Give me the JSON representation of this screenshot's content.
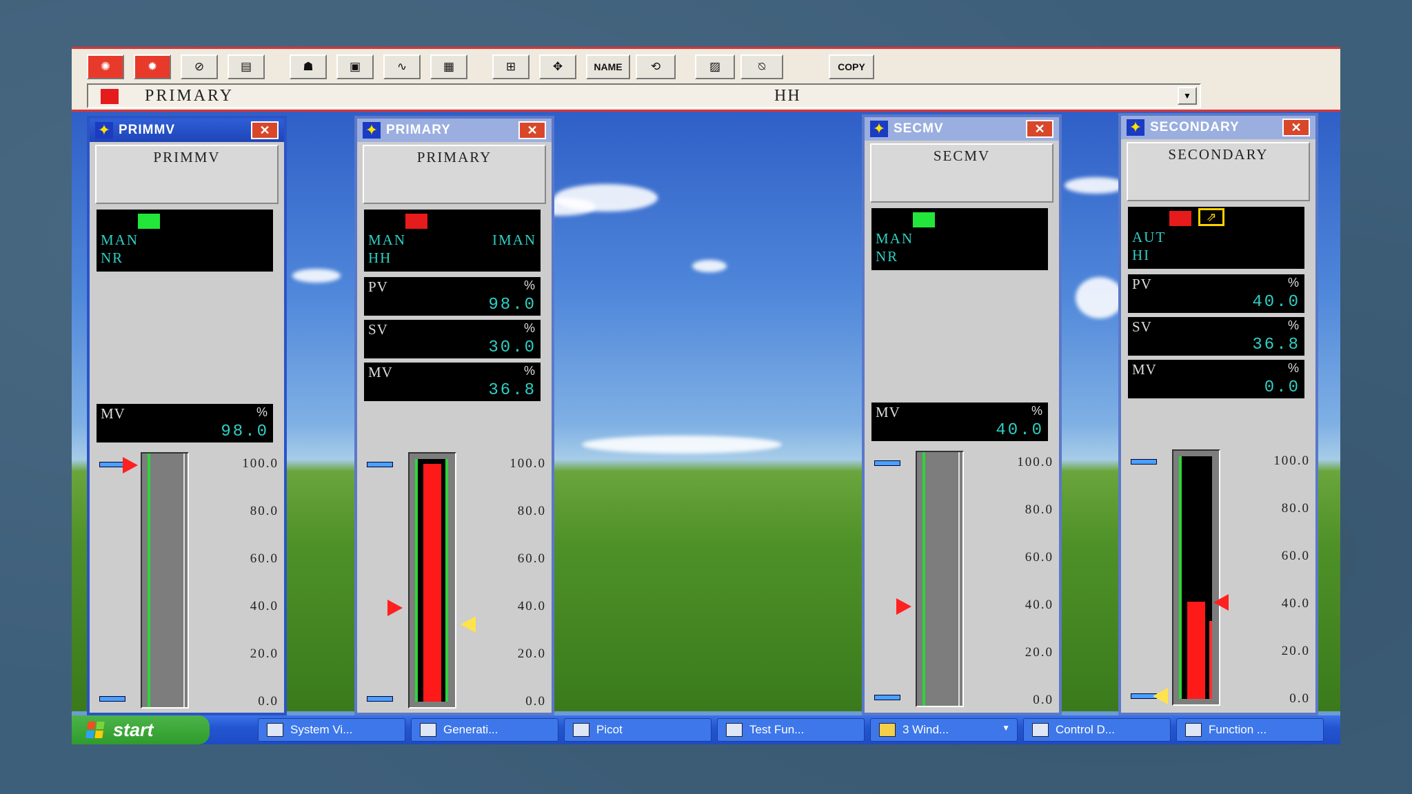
{
  "toolbar": {
    "buttons": [
      "alarm-icon",
      "process-alarm-icon",
      "operator-guide-icon",
      "message-icon",
      "operator-icon",
      "display-icon",
      "trend-icon",
      "overview-icon",
      "graphic-icon",
      "navigate-icon",
      "NAME",
      "tuning-icon",
      "filter-icon",
      "acknowledge-icon",
      "COPY"
    ],
    "name_label": "NAME",
    "copy_label": "COPY"
  },
  "tag_row": {
    "name": "PRIMARY",
    "alarm": "HH",
    "color": "#e61b1b"
  },
  "faceplates": [
    {
      "title": "PRIMMV",
      "name": "PRIMMV",
      "indicator_color": "#22e63a",
      "mode": "MAN",
      "mode2": "",
      "alarm": "NR",
      "mv": {
        "label": "MV",
        "unit": "%",
        "value": "98.0"
      },
      "scale": [
        "100.0",
        "80.0",
        "60.0",
        "40.0",
        "20.0",
        "0.0"
      ],
      "bar_percent": 0
    },
    {
      "title": "PRIMARY",
      "name": "PRIMARY",
      "indicator_color": "#e61b1b",
      "mode": "MAN",
      "mode2": "IMAN",
      "alarm": "HH",
      "pv": {
        "label": "PV",
        "unit": "%",
        "value": "98.0"
      },
      "sv": {
        "label": "SV",
        "unit": "%",
        "value": "30.0"
      },
      "mv": {
        "label": "MV",
        "unit": "%",
        "value": "36.8"
      },
      "scale": [
        "100.0",
        "80.0",
        "60.0",
        "40.0",
        "20.0",
        "0.0"
      ],
      "bar_percent": 98
    },
    {
      "title": "SECMV",
      "name": "SECMV",
      "indicator_color": "#22e63a",
      "mode": "MAN",
      "mode2": "",
      "alarm": "NR",
      "mv": {
        "label": "MV",
        "unit": "%",
        "value": "40.0"
      },
      "scale": [
        "100.0",
        "80.0",
        "60.0",
        "40.0",
        "20.0",
        "0.0"
      ],
      "bar_percent": 0
    },
    {
      "title": "SECONDARY",
      "name": "SECONDARY",
      "indicator_color": "#e61b1b",
      "mode": "AUT",
      "mode2": "",
      "alarm": "HI",
      "pv": {
        "label": "PV",
        "unit": "%",
        "value": "40.0"
      },
      "sv": {
        "label": "SV",
        "unit": "%",
        "value": "36.8"
      },
      "mv": {
        "label": "MV",
        "unit": "%",
        "value": "0.0"
      },
      "scale": [
        "100.0",
        "80.0",
        "60.0",
        "40.0",
        "20.0",
        "0.0"
      ],
      "bar_percent": 40
    }
  ],
  "taskbar": {
    "start_label": "start",
    "tasks": [
      {
        "label": "System Vi..."
      },
      {
        "label": "Generati..."
      },
      {
        "label": "Picot"
      },
      {
        "label": "Test Fun..."
      },
      {
        "label": "3 Wind..."
      },
      {
        "label": "Control D..."
      },
      {
        "label": "Function ..."
      }
    ]
  }
}
